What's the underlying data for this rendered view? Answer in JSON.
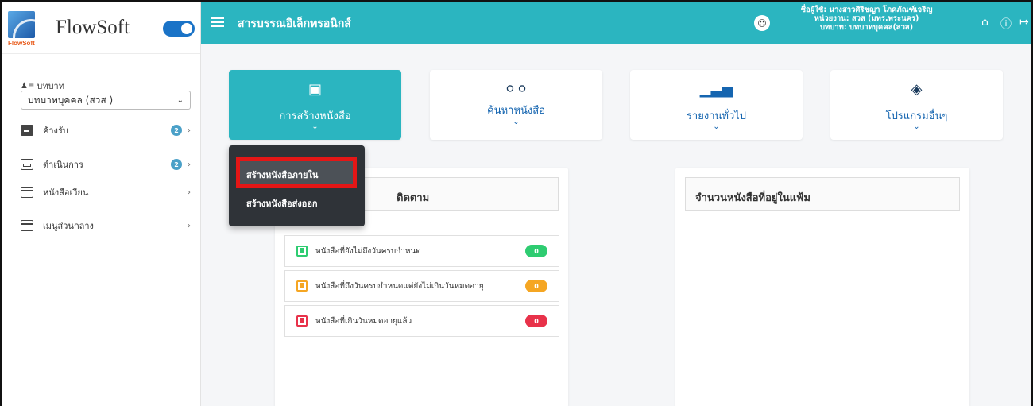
{
  "brand": {
    "logo_text": "FlowSoft",
    "name": "FlowSoft"
  },
  "sidebar": {
    "role_label": "บทบาท",
    "role_value": "บทบาทบุคคล (สวส )",
    "items": [
      {
        "label": "ค้างรับ",
        "badge": "2",
        "icon": "inbox-filled-icon"
      },
      {
        "label": "ดำเนินการ",
        "badge": "2",
        "icon": "inbox-outline-icon"
      },
      {
        "label": "หนังสือเวียน",
        "icon": "document-icon"
      },
      {
        "label": "เมนูส่วนกลาง",
        "icon": "document-icon"
      }
    ]
  },
  "topbar": {
    "title": "สารบรรณอิเล็กทรอนิกส์",
    "user_line1": "ชื่อผู้ใช้: นางสาวศิริชญา โภคภัณฑ์เจริญ",
    "user_line2": "หน่วยงาน: สวส (มทร.พระนคร)",
    "user_line3": "บทบาท: บทบาทบุคคล(สวส)"
  },
  "cards": [
    {
      "label": "การสร้างหนังสือ",
      "icon": "book-icon",
      "active": true
    },
    {
      "label": "ค้นหาหนังสือ",
      "icon": "binoculars-icon"
    },
    {
      "label": "รายงานทั่วไป",
      "icon": "bar-chart-icon"
    },
    {
      "label": "โปรแกรมอื่นๆ",
      "icon": "layers-icon"
    }
  ],
  "dropdown": {
    "items": [
      "สร้างหนังสือภายใน",
      "สร้างหนังสือส่งออก"
    ]
  },
  "panels": {
    "left_title": "หนังสือติดตาม",
    "left_title_visible": "ติดตาม",
    "right_title": "จำนวนหนังสือที่อยู่ในแฟ้ม",
    "rows": [
      {
        "label": "หนังสือที่ยังไม่ถึงวันครบกำหนด",
        "count": "0",
        "color": "#2ecc71"
      },
      {
        "label": "หนังสือที่ถึงวันครบกำหนดแต่ยังไม่เกินวันหมดอายุ",
        "count": "0",
        "color": "#f5a623"
      },
      {
        "label": "หนังสือที่เกินวันหมดอายุแล้ว",
        "count": "0",
        "color": "#e8324a"
      }
    ]
  },
  "colors": {
    "primary": "#2bb5c0",
    "highlight": "#e41616"
  }
}
